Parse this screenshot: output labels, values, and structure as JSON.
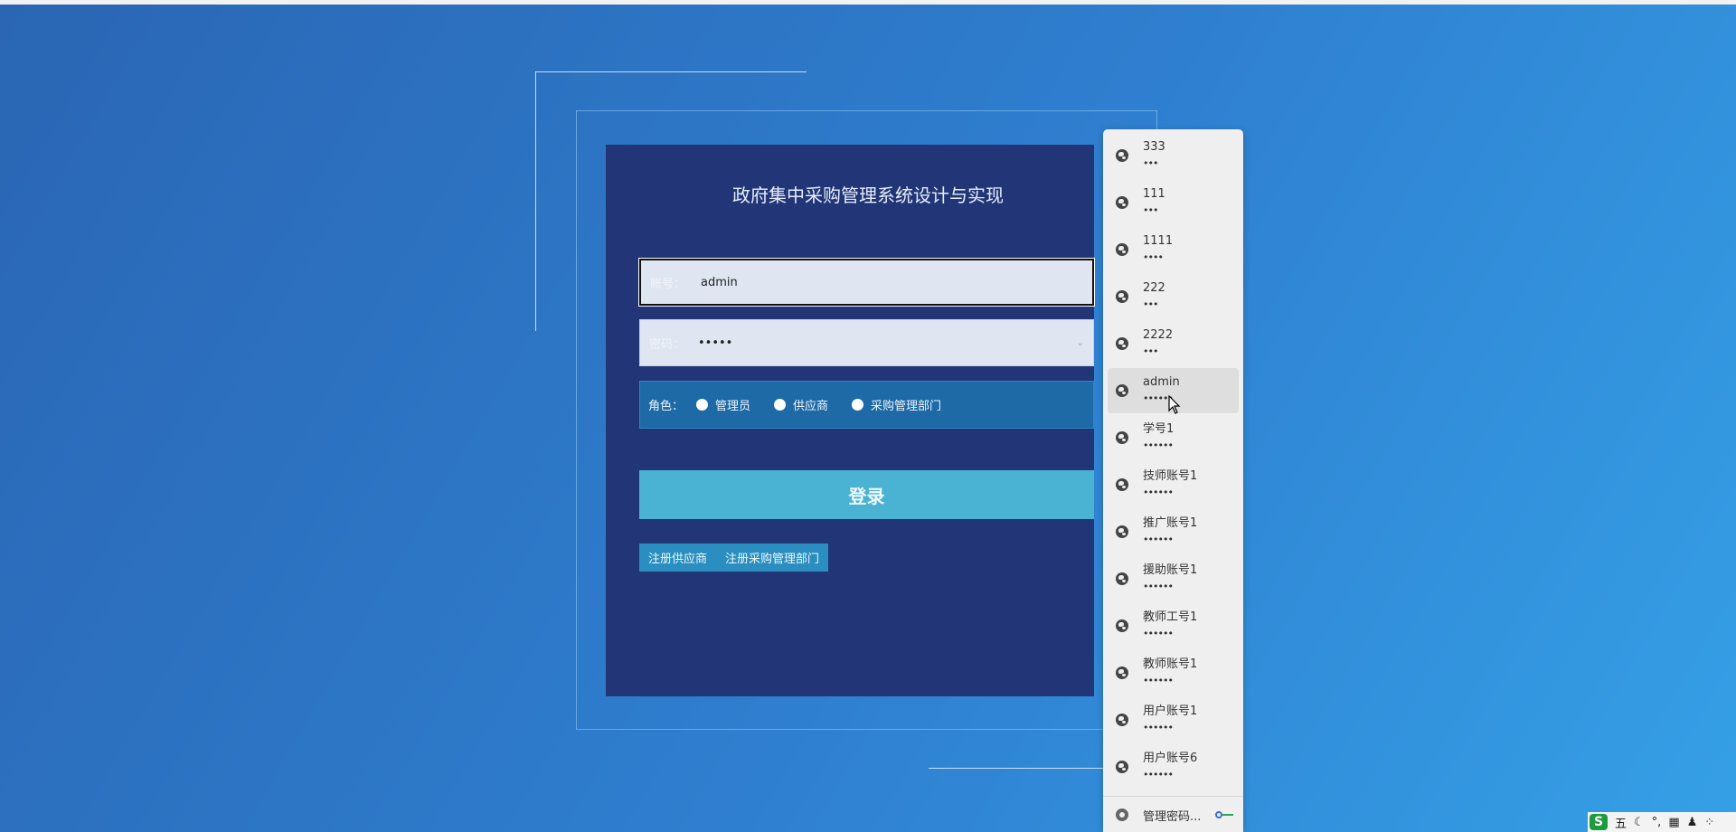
{
  "login": {
    "title": "政府集中采购管理系统设计与实现",
    "username_label": "账号：",
    "username_value": "admin",
    "password_label": "密码：",
    "password_value": "•••••",
    "role_label": "角色：",
    "roles": [
      "管理员",
      "供应商",
      "采购管理部门"
    ],
    "login_button": "登录",
    "register_links": [
      "注册供应商",
      "注册采购管理部门"
    ]
  },
  "password_dropdown": {
    "items": [
      {
        "user": "333",
        "mask": "•••"
      },
      {
        "user": "111",
        "mask": "•••"
      },
      {
        "user": "1111",
        "mask": "••••"
      },
      {
        "user": "222",
        "mask": "•••"
      },
      {
        "user": "2222",
        "mask": "•••"
      },
      {
        "user": "admin",
        "mask": "••••••"
      },
      {
        "user": "学号1",
        "mask": "••••••"
      },
      {
        "user": "技师账号1",
        "mask": "••••••"
      },
      {
        "user": "推广账号1",
        "mask": "••••••"
      },
      {
        "user": "援助账号1",
        "mask": "••••••"
      },
      {
        "user": "教师工号1",
        "mask": "••••••"
      },
      {
        "user": "教师账号1",
        "mask": "••••••"
      },
      {
        "user": "用户账号1",
        "mask": "••••••"
      },
      {
        "user": "用户账号6",
        "mask": "••••••"
      }
    ],
    "hovered_index": 5,
    "manage_label": "管理密码..."
  },
  "tray": {
    "ime_logo": "S",
    "ime_mode": "五",
    "moon": "☾",
    "punct": "°,",
    "keyboard": "▦",
    "user": "♟",
    "grid": "⁘"
  },
  "colors": {
    "panel": "#213577",
    "login_button": "#4ab2d2",
    "role_row": "#1d6aa6"
  }
}
